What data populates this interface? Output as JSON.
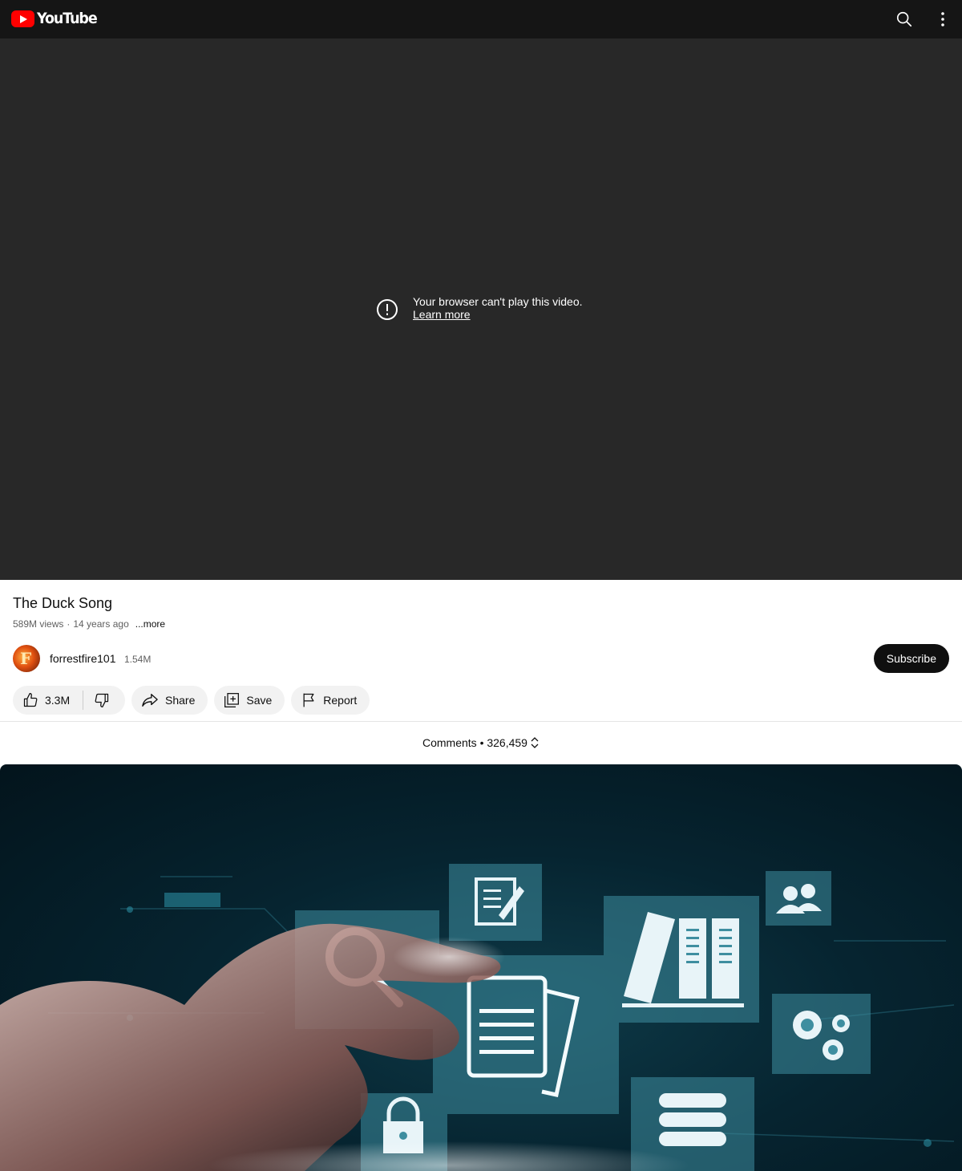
{
  "app": {
    "logo_text": "YouTube",
    "brand_color": "#ff0000"
  },
  "header": {
    "search_icon": "search-icon",
    "more_icon": "more-vert-icon"
  },
  "player": {
    "error_message": "Your browser can't play this video.",
    "learn_more": "Learn more",
    "error_icon": "alert-circle-icon"
  },
  "video": {
    "title": "The Duck Song",
    "views": "589M views",
    "separator": "·",
    "age": "14 years ago",
    "more_label": "...more"
  },
  "channel": {
    "name": "forrestfire101",
    "subscribers": "1.54M",
    "subscribe_label": "Subscribe"
  },
  "actions": {
    "like_count": "3.3M",
    "share_label": "Share",
    "save_label": "Save",
    "report_label": "Report"
  },
  "comments": {
    "label": "Comments • 326,459"
  },
  "ad": {
    "icons": [
      "search-icon",
      "document-edit-icon",
      "documents-icon",
      "library-icon",
      "users-icon",
      "gears-icon",
      "server-icon",
      "lock-icon"
    ]
  }
}
